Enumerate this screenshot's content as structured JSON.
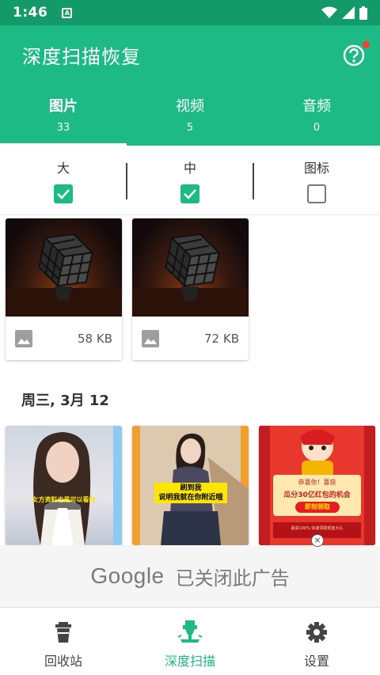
{
  "status": {
    "time": "1:46",
    "sim_badge": "A"
  },
  "app": {
    "title": "深度扫描恢复"
  },
  "tabs": [
    {
      "label": "图片",
      "count": "33"
    },
    {
      "label": "视频",
      "count": "5"
    },
    {
      "label": "音频",
      "count": "0"
    }
  ],
  "filters": [
    {
      "label": "大",
      "checked": true
    },
    {
      "label": "中",
      "checked": true
    },
    {
      "label": "图标",
      "checked": false
    }
  ],
  "images": [
    {
      "size": "58 KB",
      "icon": "image-icon"
    },
    {
      "size": "72 KB",
      "icon": "image-icon"
    }
  ],
  "section": {
    "date": "周三, 3月 12"
  },
  "thumb_texts": {
    "photo1_caption": "女方资料也是可以看的",
    "photo2_caption_line1": "刷到我",
    "photo2_caption_line2": "说明我就在你附近哦",
    "promo_line1": "恭喜你！喜获",
    "promo_line2": "瓜分30亿红包的机会",
    "promo_button": "即刻领取",
    "promo_footer": "最高100% 快速领取现金大礼"
  },
  "ad": {
    "brand": "Google",
    "message": "已关闭此广告",
    "close": "×"
  },
  "bottom_nav": [
    {
      "label": "回收站",
      "icon": "trash-icon"
    },
    {
      "label": "深度扫描",
      "icon": "drill-icon"
    },
    {
      "label": "设置",
      "icon": "gear-icon"
    }
  ],
  "colors": {
    "status_bar": "#149968",
    "app_bar": "#1dba85",
    "accent": "#1dba85"
  }
}
